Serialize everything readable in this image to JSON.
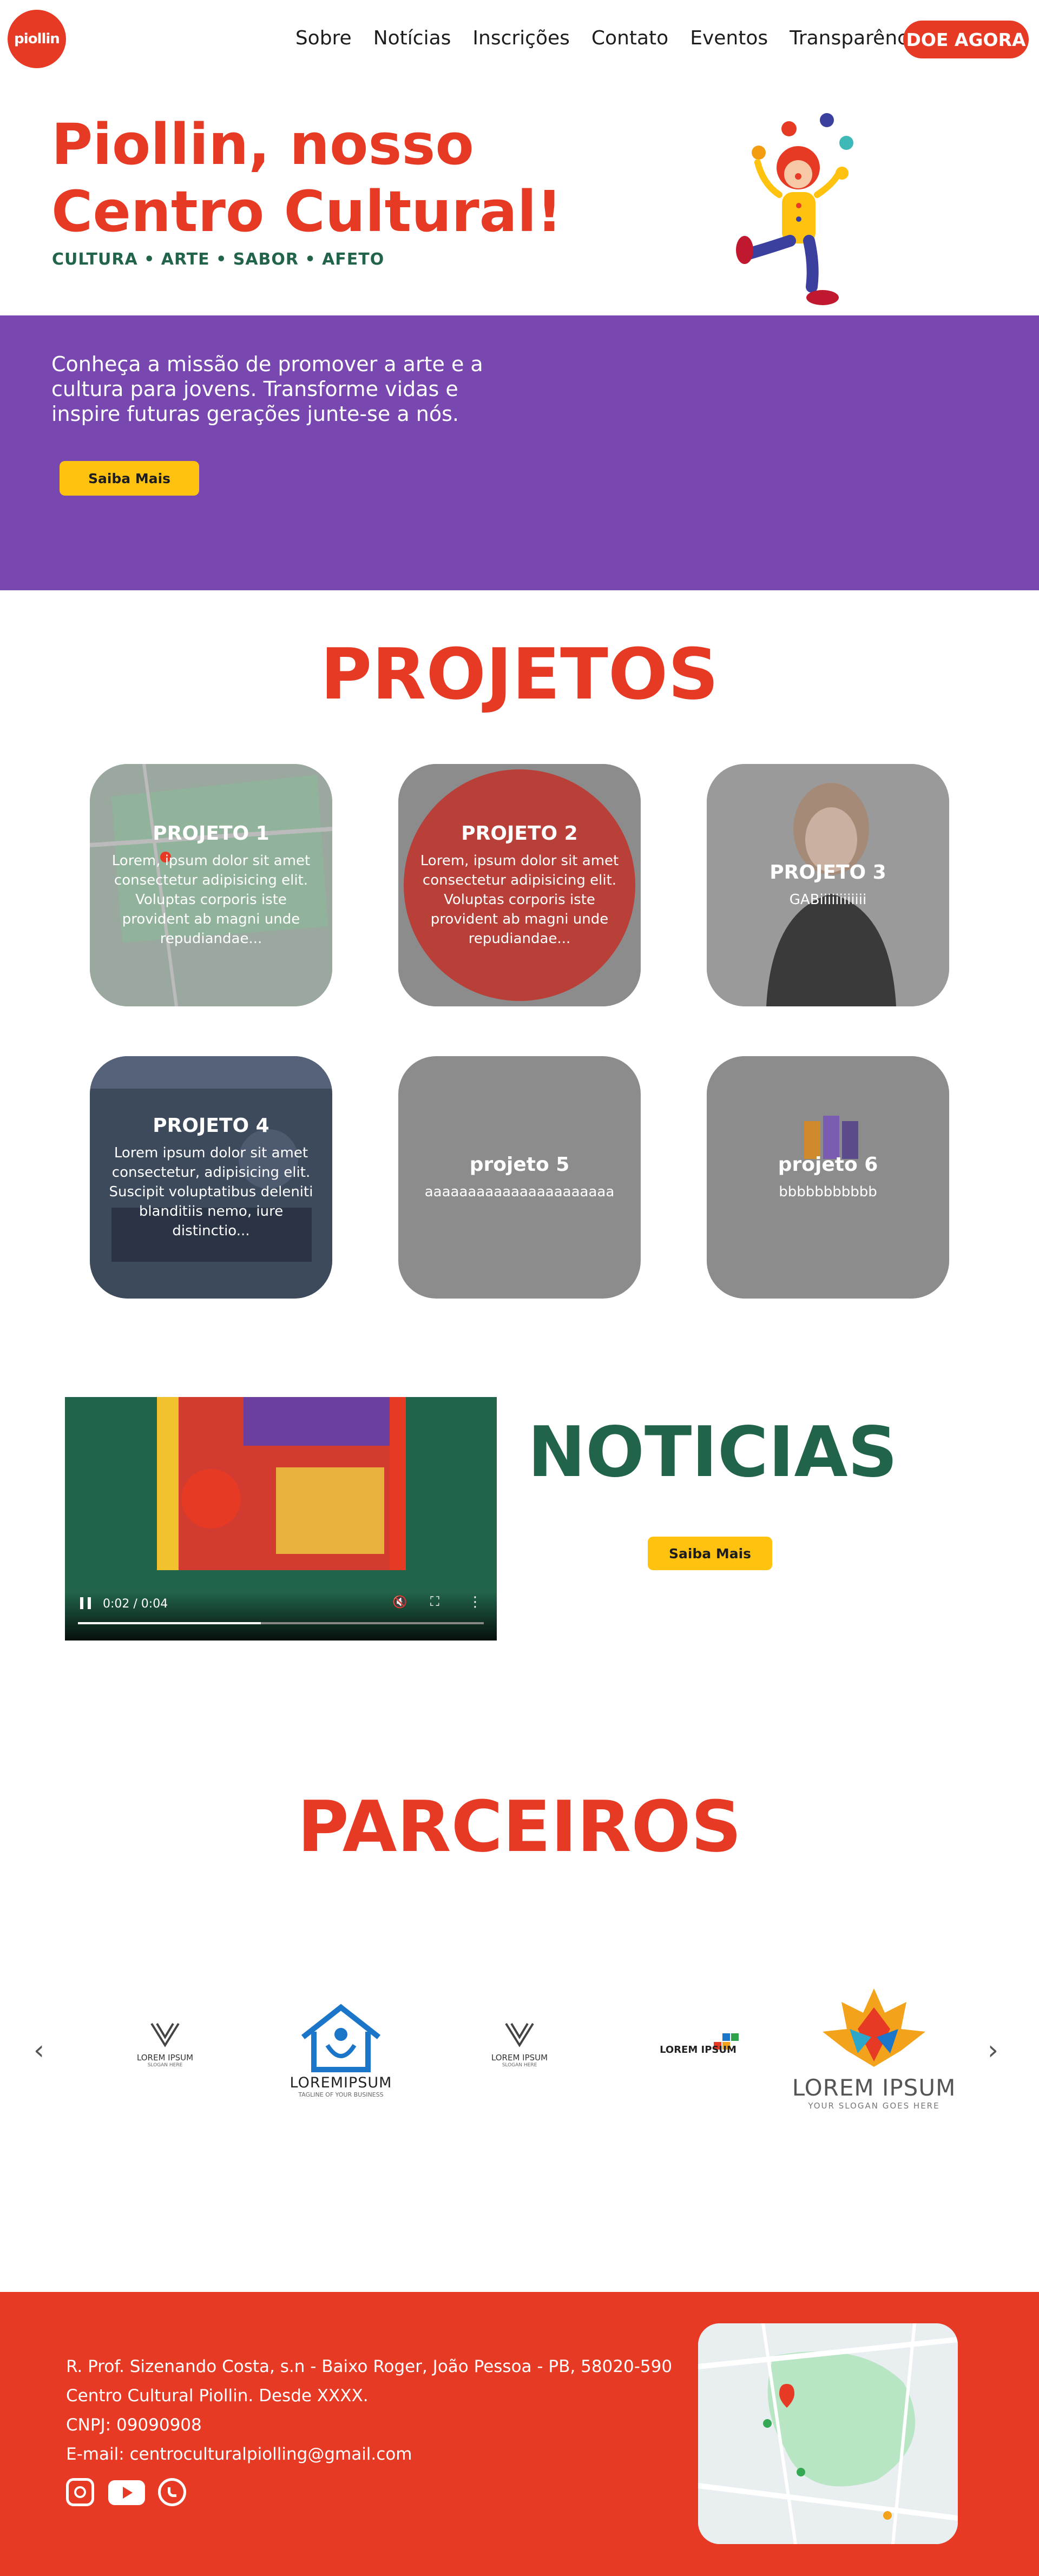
{
  "nav": {
    "logo_text": "piollin",
    "items": [
      "Sobre",
      "Notícias",
      "Inscrições",
      "Contato",
      "Eventos",
      "Transparência"
    ],
    "donate_label": "DOE AGORA"
  },
  "hero": {
    "title_line1": "Piollin, nosso",
    "title_line2": "Centro Cultural!",
    "tagline": "CULTURA • ARTE • SABOR • AFETO",
    "description": "Conheça a missão de promover a arte e a cultura para jovens. Transforme vidas e inspire futuras gerações junte-se a nós.",
    "button_label": "Saiba Mais"
  },
  "projetos": {
    "title": "PROJETOS",
    "cards": [
      {
        "title": "PROJETO 1",
        "desc": "Lorem, ipsum dolor sit amet consectetur adipisicing elit. Voluptas corporis iste provident ab magni unde repudiandae..."
      },
      {
        "title": "PROJETO 2",
        "desc": "Lorem, ipsum dolor sit amet consectetur adipisicing elit. Voluptas corporis iste provident ab magni unde repudiandae..."
      },
      {
        "title": "PROJETO 3",
        "desc": "GABiiiiiiiiiiii"
      },
      {
        "title": "PROJETO 4",
        "desc": "Lorem ipsum dolor sit amet consectetur, adipisicing elit. Suscipit voluptatibus deleniti blanditiis nemo, iure distinctio..."
      },
      {
        "title": "projeto 5",
        "desc": "aaaaaaaaaaaaaaaaaaaaaa"
      },
      {
        "title": "projeto 6",
        "desc": "bbbbbbbbbbb"
      }
    ]
  },
  "noticias": {
    "title": "NOTICIAS",
    "video_time": "0:02 / 0:04",
    "button_label": "Saiba Mais"
  },
  "parceiros": {
    "title": "PARCEIROS",
    "logos": [
      {
        "name": "LOREM IPSUM",
        "sub": "SLOGAN HERE"
      },
      {
        "name": "LOREMIPSUM",
        "sub": "TAGLINE OF YOUR BUSINESS"
      },
      {
        "name": "LOREM IPSUM",
        "sub": "SLOGAN HERE"
      },
      {
        "name": "LOREM IPSUM",
        "sub": ""
      },
      {
        "name": "LOREM IPSUM",
        "sub": "YOUR SLOGAN GOES HERE"
      }
    ]
  },
  "footer": {
    "address": "R. Prof. Sizenando Costa, s.n - Baixo Roger, João Pessoa - PB, 58020-590",
    "since": "Centro Cultural Piollin. Desde XXXX.",
    "cnpj": "CNPJ: 09090908",
    "email": "E-mail: centroculturalpiolling@gmail.com"
  }
}
